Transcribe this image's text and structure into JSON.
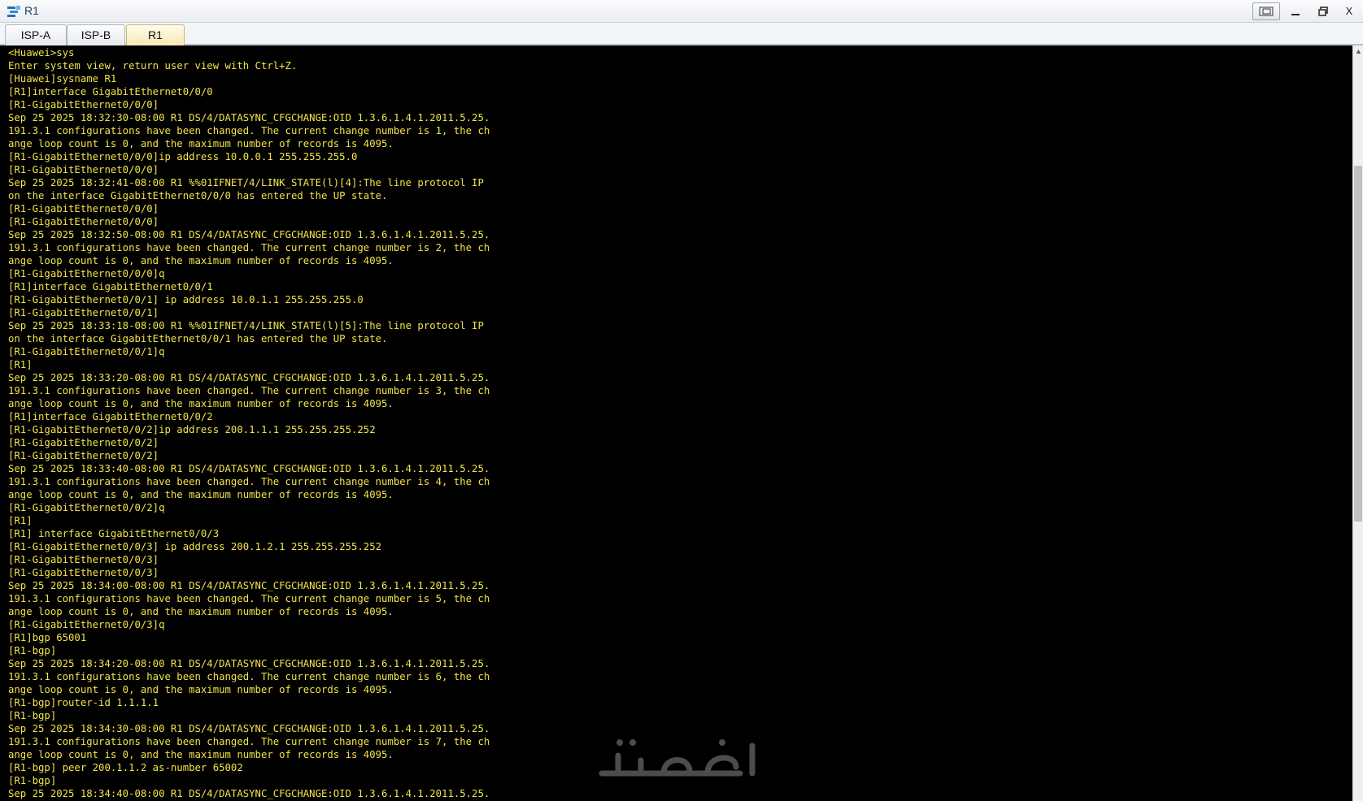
{
  "window": {
    "title": "R1",
    "controls": {
      "restore_alt": "",
      "minimize": "",
      "maximize": "",
      "close": "X"
    }
  },
  "tabs": [
    {
      "label": "ISP-A",
      "active": false
    },
    {
      "label": "ISP-B",
      "active": false
    },
    {
      "label": "R1",
      "active": true
    }
  ],
  "terminal": {
    "text_color": "#f2e34a",
    "background": "#000000",
    "lines": [
      "<Huawei>sys",
      "Enter system view, return user view with Ctrl+Z.",
      "[Huawei]sysname R1",
      "[R1]interface GigabitEthernet0/0/0",
      "[R1-GigabitEthernet0/0/0]",
      "Sep 25 2025 18:32:30-08:00 R1 DS/4/DATASYNC_CFGCHANGE:OID 1.3.6.1.4.1.2011.5.25.",
      "191.3.1 configurations have been changed. The current change number is 1, the ch",
      "ange loop count is 0, and the maximum number of records is 4095.",
      "[R1-GigabitEthernet0/0/0]ip address 10.0.0.1 255.255.255.0",
      "[R1-GigabitEthernet0/0/0]",
      "Sep 25 2025 18:32:41-08:00 R1 %%01IFNET/4/LINK_STATE(l)[4]:The line protocol IP",
      "on the interface GigabitEthernet0/0/0 has entered the UP state.",
      "[R1-GigabitEthernet0/0/0]",
      "[R1-GigabitEthernet0/0/0]",
      "Sep 25 2025 18:32:50-08:00 R1 DS/4/DATASYNC_CFGCHANGE:OID 1.3.6.1.4.1.2011.5.25.",
      "191.3.1 configurations have been changed. The current change number is 2, the ch",
      "ange loop count is 0, and the maximum number of records is 4095.",
      "[R1-GigabitEthernet0/0/0]q",
      "[R1]interface GigabitEthernet0/0/1",
      "[R1-GigabitEthernet0/0/1] ip address 10.0.1.1 255.255.255.0",
      "[R1-GigabitEthernet0/0/1]",
      "Sep 25 2025 18:33:18-08:00 R1 %%01IFNET/4/LINK_STATE(l)[5]:The line protocol IP",
      "on the interface GigabitEthernet0/0/1 has entered the UP state.",
      "[R1-GigabitEthernet0/0/1]q",
      "[R1]",
      "Sep 25 2025 18:33:20-08:00 R1 DS/4/DATASYNC_CFGCHANGE:OID 1.3.6.1.4.1.2011.5.25.",
      "191.3.1 configurations have been changed. The current change number is 3, the ch",
      "ange loop count is 0, and the maximum number of records is 4095.",
      "[R1]interface GigabitEthernet0/0/2",
      "[R1-GigabitEthernet0/0/2]ip address 200.1.1.1 255.255.255.252",
      "[R1-GigabitEthernet0/0/2]",
      "[R1-GigabitEthernet0/0/2]",
      "Sep 25 2025 18:33:40-08:00 R1 DS/4/DATASYNC_CFGCHANGE:OID 1.3.6.1.4.1.2011.5.25.",
      "191.3.1 configurations have been changed. The current change number is 4, the ch",
      "ange loop count is 0, and the maximum number of records is 4095.",
      "[R1-GigabitEthernet0/0/2]q",
      "[R1]",
      "[R1] interface GigabitEthernet0/0/3",
      "[R1-GigabitEthernet0/0/3] ip address 200.1.2.1 255.255.255.252",
      "[R1-GigabitEthernet0/0/3]",
      "[R1-GigabitEthernet0/0/3]",
      "Sep 25 2025 18:34:00-08:00 R1 DS/4/DATASYNC_CFGCHANGE:OID 1.3.6.1.4.1.2011.5.25.",
      "191.3.1 configurations have been changed. The current change number is 5, the ch",
      "ange loop count is 0, and the maximum number of records is 4095.",
      "[R1-GigabitEthernet0/0/3]q",
      "[R1]bgp 65001",
      "[R1-bgp]",
      "Sep 25 2025 18:34:20-08:00 R1 DS/4/DATASYNC_CFGCHANGE:OID 1.3.6.1.4.1.2011.5.25.",
      "191.3.1 configurations have been changed. The current change number is 6, the ch",
      "ange loop count is 0, and the maximum number of records is 4095.",
      "[R1-bgp]router-id 1.1.1.1",
      "[R1-bgp]",
      "Sep 25 2025 18:34:30-08:00 R1 DS/4/DATASYNC_CFGCHANGE:OID 1.3.6.1.4.1.2011.5.25.",
      "191.3.1 configurations have been changed. The current change number is 7, the ch",
      "ange loop count is 0, and the maximum number of records is 4095.",
      "[R1-bgp] peer 200.1.1.2 as-number 65002",
      "[R1-bgp]",
      "Sep 25 2025 18:34:40-08:00 R1 DS/4/DATASYNC_CFGCHANGE:OID 1.3.6.1.4.1.2011.5.25."
    ]
  },
  "scrollbar": {
    "up_arrow": "▲",
    "position_fraction": 0.16
  },
  "watermark": {
    "text": "خدمات"
  }
}
